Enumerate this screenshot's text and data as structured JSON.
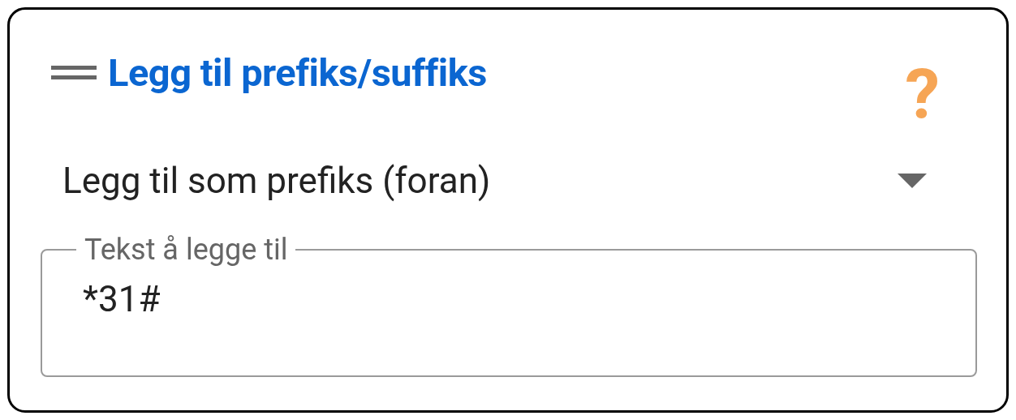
{
  "card": {
    "title": "Legg til prefiks/suffiks",
    "help": "?"
  },
  "dropdown": {
    "value": "Legg til som prefiks (foran)"
  },
  "text_field": {
    "label": "Tekst å legge til",
    "value": "*31#"
  }
}
